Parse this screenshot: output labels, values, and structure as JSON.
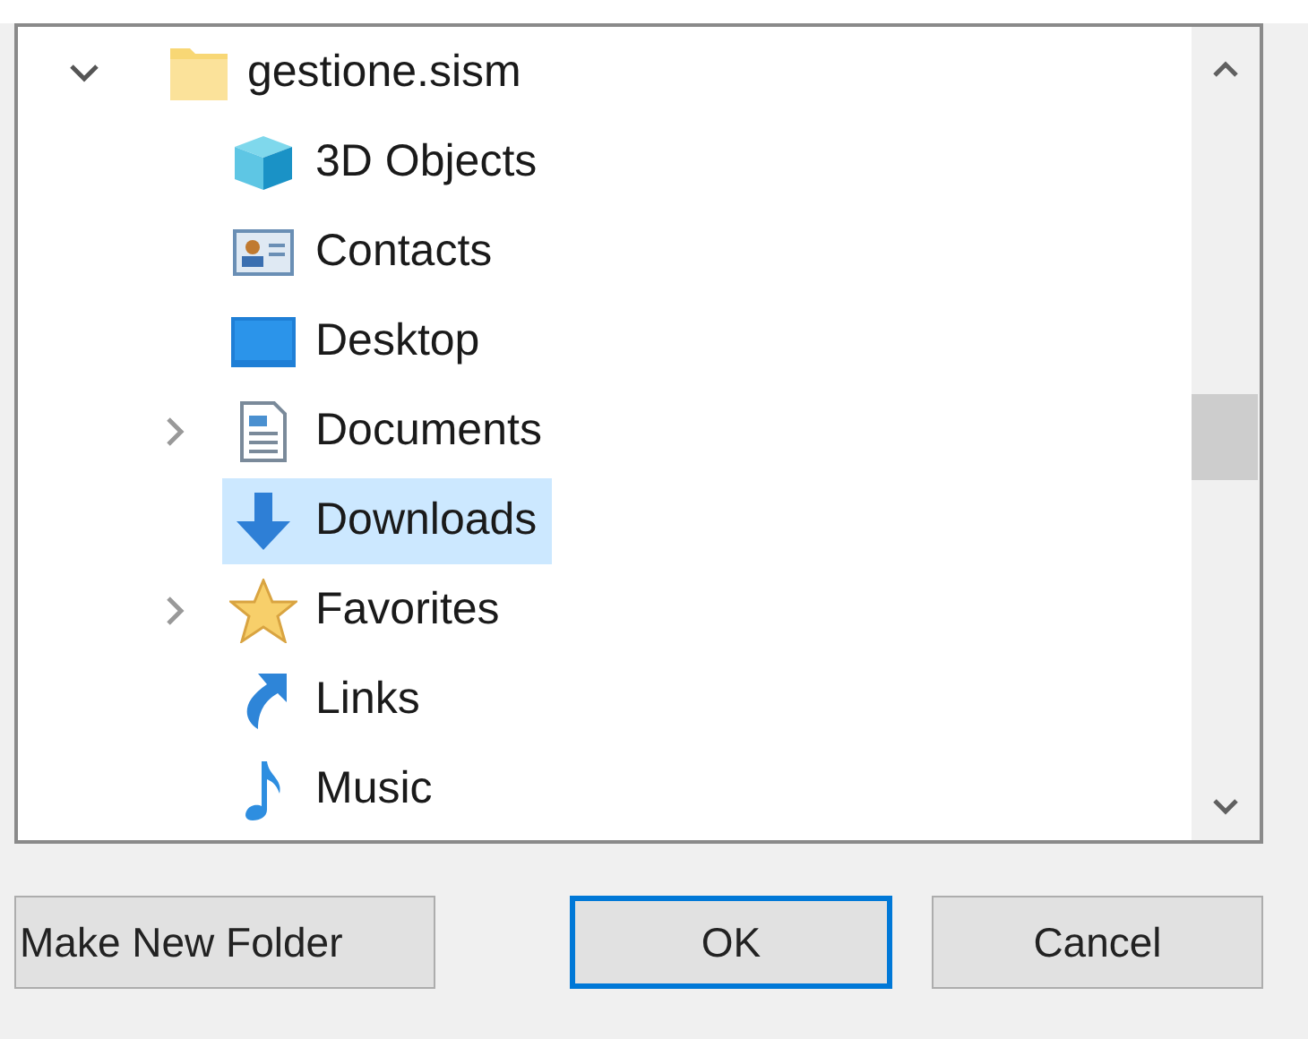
{
  "tree": [
    {
      "label": "gestione.sism",
      "expanded": true,
      "selected": false,
      "children": [
        {
          "label": "3D Objects",
          "expandable": false,
          "selected": false
        },
        {
          "label": "Contacts",
          "expandable": false,
          "selected": false
        },
        {
          "label": "Desktop",
          "expandable": false,
          "selected": false
        },
        {
          "label": "Documents",
          "expandable": true,
          "selected": false
        },
        {
          "label": "Downloads",
          "expandable": false,
          "selected": true
        },
        {
          "label": "Favorites",
          "expandable": true,
          "selected": false
        },
        {
          "label": "Links",
          "expandable": false,
          "selected": false
        },
        {
          "label": "Music",
          "expandable": false,
          "selected": false
        }
      ]
    }
  ],
  "buttons": [
    {
      "label": "Make New Folder",
      "default": false
    },
    {
      "label": "OK",
      "default": true
    },
    {
      "label": "Cancel",
      "default": false
    }
  ]
}
